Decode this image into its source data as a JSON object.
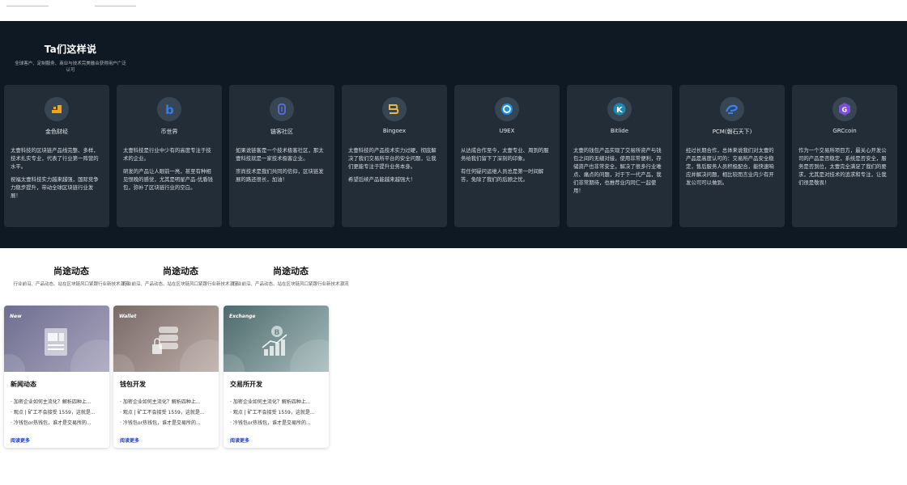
{
  "top_links": [
    "",
    ""
  ],
  "testimonials": {
    "title": "Ta们这样说",
    "subtitle": "全球客户、定制服务、商业与技术完美融合获得用户广泛认可",
    "cards": [
      {
        "name": "金色财经",
        "icon": "jinse-logo-icon",
        "paragraphs": [
          "太壹科技的区块链产品线完整、多样，技术扎实专业，代表了行业第一阵营的水平。",
          "祝福太壹科技实力越来越强，国际竞争力稳步提升，带动全球区块链行业发展！"
        ]
      },
      {
        "name": "币世界",
        "icon": "bishijie-logo-icon",
        "paragraphs": [
          "太壹科技是行业中少有的高度专注于技术的企业。",
          "研发的产品让人眼前一亮，甚至有种相见恨晚的感觉，尤其是明星产品-优盾钱包，弥补了区块链行业的空白。"
        ]
      },
      {
        "name": "链客社区",
        "icon": "lianke-logo-icon",
        "paragraphs": [
          "如果说链客是一个技术极客社区，那太壹科技就是一家技术极客企业。",
          "崇尚技术是我们共同的信仰，区块链发展的路还很长，加油！"
        ]
      },
      {
        "name": "Bingoex",
        "icon": "bingoex-logo-icon",
        "paragraphs": [
          "太壹科技的产品技术实力过硬，彻底解决了我们交易所平台的安全问题，让我们更能专注于提升业务本身。",
          "希望后续产品能越来越强大！"
        ]
      },
      {
        "name": "U9EX",
        "icon": "u9ex-logo-icon",
        "paragraphs": [
          "从达成合作至今，太壹专业、周到的服务给我们留下了深刻的印象。",
          "有任何疑问运维人员总是第一时间解答，免除了我们的后顾之忧。"
        ]
      },
      {
        "name": "Bitlide",
        "icon": "bitlide-logo-icon",
        "paragraphs": [
          "太壹的钱包产品实现了交易所资产与钱包之间的无缝对接，使用非常便利，存储资产也非常安全，解决了很多行业难点、痛点的问题，对于下一代产品，我们非常期待，也推荐业内同仁一起使用！"
        ]
      },
      {
        "name": "PCM(磐石天下)",
        "icon": "pcm-logo-icon",
        "paragraphs": [
          "经过长期合作，总体来说我们对太壹的产品是高度认可的：交易所产品安全稳定，售后服务人员积极配合，能快速响应并解决问题，相比较而言业内少有开发公司可以做到。"
        ]
      },
      {
        "name": "GRCcoin",
        "icon": "grccoin-logo-icon",
        "paragraphs": [
          "作为一个交易所项目方，最关心开发公司的产品是否稳定，系统是否安全，服务是否到位，太壹完全满足了我们的要求，尤其是对技术的追求和专注，让我们很是敬畏！"
        ]
      }
    ]
  },
  "news": {
    "headers": [
      {
        "title": "尚途动态",
        "subtitle": "行业前沿、产品动态、站在区块链风口紧跟行业新技术潮流"
      },
      {
        "title": "尚途动态",
        "subtitle": "行业前沿、产品动态、站在区块链风口紧跟行业新技术潮流"
      },
      {
        "title": "尚途动态",
        "subtitle": "行业前沿、产品动态、站在区块链风口紧跟行业新技术潮流"
      }
    ],
    "cards": [
      {
        "tag": "New",
        "title": "新闻动态",
        "items": [
          "· 加密企业如何主流化？解析四种上...",
          "· 观点 | 矿工不会接受 1559，这就是...",
          "· 冷钱包or热钱包，谁才是交易所的..."
        ],
        "more": "阅读更多",
        "icon": "news-document-icon",
        "color_a": "#6f6e8f",
        "color_b": "#a7a4bd"
      },
      {
        "tag": "Wallet",
        "title": "钱包开发",
        "items": [
          "· 加密企业如何主流化？解析四种上...",
          "· 观点 | 矿工不会接受 1559，这就是...",
          "· 冷钱包or热钱包，谁才是交易所的..."
        ],
        "more": "阅读更多",
        "icon": "wallet-database-icon",
        "color_a": "#7a6a68",
        "color_b": "#bdaea9"
      },
      {
        "tag": "Exchange",
        "title": "交易所开发",
        "items": [
          "· 加密企业如何主流化？解析四种上...",
          "· 观点 | 矿工不会接受 1559，这就是...",
          "· 冷钱包or热钱包，谁才是交易所的..."
        ],
        "more": "阅读更多",
        "icon": "exchange-bitcoin-chart-icon",
        "color_a": "#4e6a6c",
        "color_b": "#a6bcbd"
      }
    ]
  }
}
